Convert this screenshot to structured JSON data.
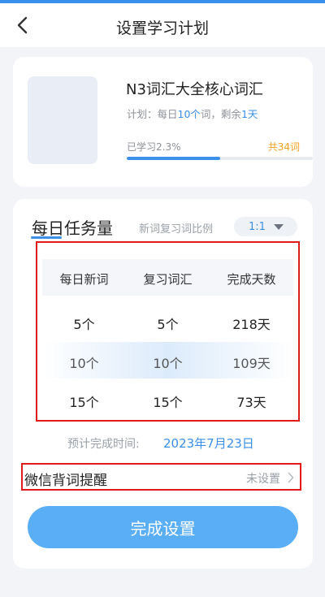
{
  "header": {
    "title": "设置学习计划",
    "back_icon": "chevron-left-icon"
  },
  "book": {
    "name": "N3词汇大全核心词汇",
    "plan_prefix": "计划：每日",
    "plan_daily": "10个",
    "plan_middle": "词，剩余",
    "plan_remaining": "1天",
    "progress_label": "已学习2.3%",
    "progress_percent": 2.3,
    "total_label": "共34词"
  },
  "task": {
    "title": "每日任务量",
    "ratio_label": "新词复习词比例",
    "ratio_value": "1:1",
    "columns": [
      "每日新词",
      "复习词汇",
      "完成天数"
    ],
    "rows": [
      {
        "new": "5个",
        "review": "5个",
        "days": "218天"
      },
      {
        "new": "10个",
        "review": "10个",
        "days": "109天"
      },
      {
        "new": "15个",
        "review": "15个",
        "days": "73天"
      }
    ],
    "selected_row": 1,
    "finish_label": "预计完成时间:",
    "finish_date": "2023年7月23日"
  },
  "reminder": {
    "label": "微信背词提醒",
    "status": "未设置",
    "chevron_icon": "chevron-right-icon"
  },
  "submit": {
    "label": "完成设置"
  },
  "colors": {
    "accent": "#3a8fe8",
    "button": "#5aaef5",
    "highlight_box": "#e01b1b",
    "total_orange": "#f0a020"
  }
}
